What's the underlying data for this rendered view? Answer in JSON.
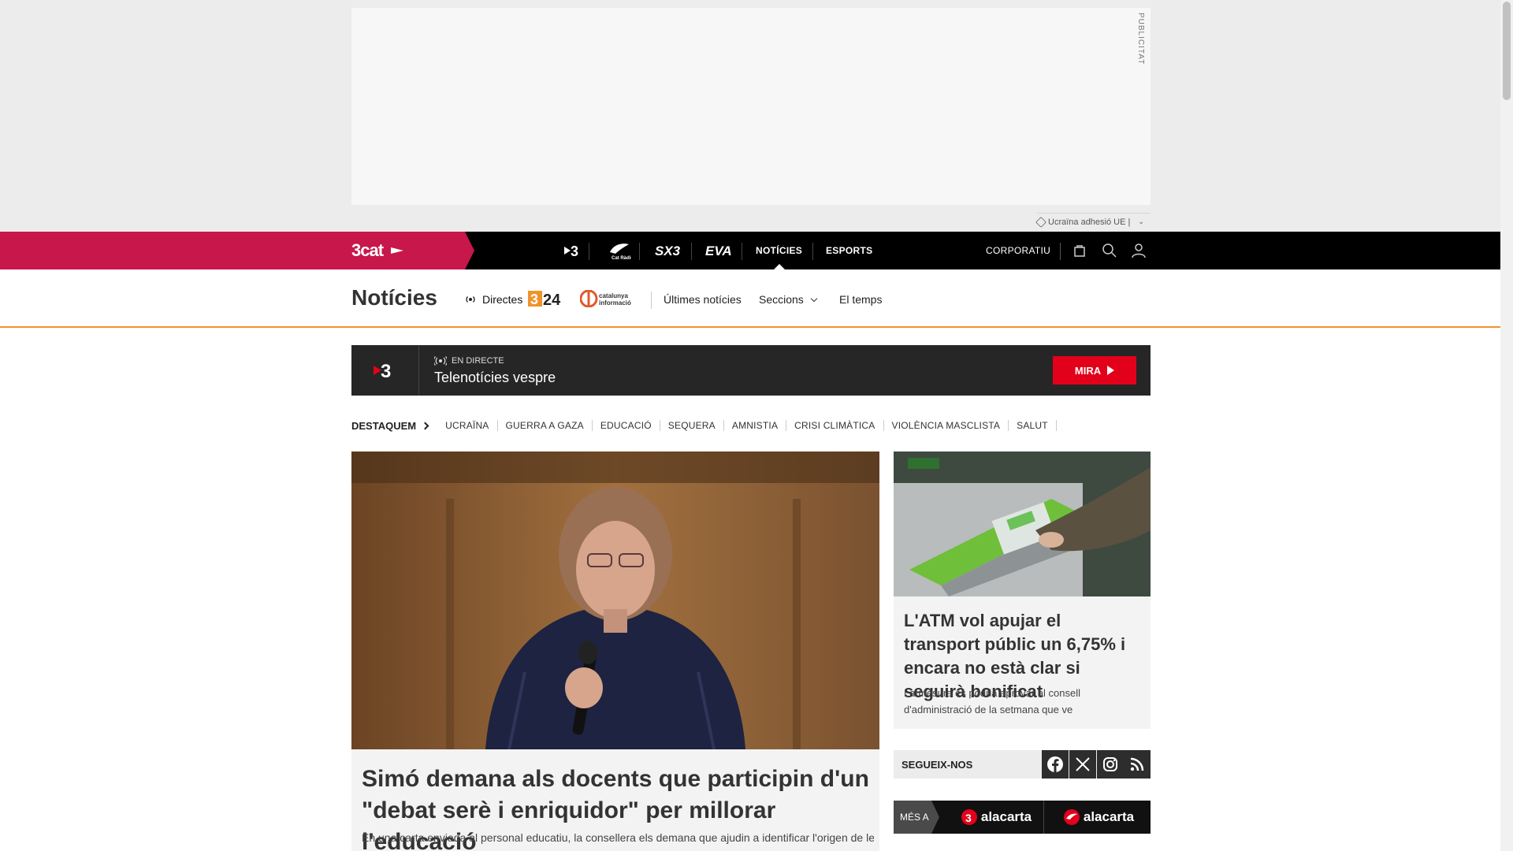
{
  "ad": {
    "label": "PUBLICITAT",
    "ticker_text": "Ucraïna adhesió UE |"
  },
  "topnav": {
    "brand": "3cat",
    "channels": [
      "3",
      "Cat Ràdio",
      "SX3",
      "EVA"
    ],
    "links": [
      "NOTÍCIES",
      "ESPORTS"
    ],
    "corporate": "CORPORATIU"
  },
  "subnav": {
    "title": "Notícies",
    "directes": "Directes",
    "links": [
      "Últimes notícies",
      "Seccions",
      "El temps"
    ]
  },
  "live": {
    "badge": "EN DIRECTE",
    "title": "Telenotícies vespre",
    "button": "MIRA"
  },
  "destaquem": {
    "label": "DESTAQUEM",
    "tags": [
      "UCRAÏNA",
      "GUERRA A GAZA",
      "EDUCACIÓ",
      "SEQUERA",
      "AMNISTIA",
      "CRISI CLIMÀTICA",
      "VIOLÈNCIA MASCLISTA",
      "SALUT"
    ]
  },
  "main_article": {
    "title": "Simó demana als docents que participin d'un \"debat serè i enriquidor\" per millorar l'educació",
    "lede": "En una carta enviada al personal educatiu, la consellera els demana que ajudin a identificar l'origen de les"
  },
  "side_article": {
    "title": "L'ATM vol apujar el transport públic un 6,75% i encara no està clar si seguirà bonificat",
    "lede": "La mesura es podria aprovar al consell d'administració de la setmana que ve"
  },
  "follow": {
    "label": "SEGUEIX-NOS",
    "networks": [
      "facebook-icon",
      "x-icon",
      "instagram-icon",
      "rss-icon"
    ]
  },
  "alacarta": {
    "label": "MÉS A",
    "items": [
      "alacarta",
      "alacarta"
    ]
  },
  "colors": {
    "brand": "#c8174a",
    "live_button": "#e3001b",
    "accent_line": "#f0932b"
  }
}
